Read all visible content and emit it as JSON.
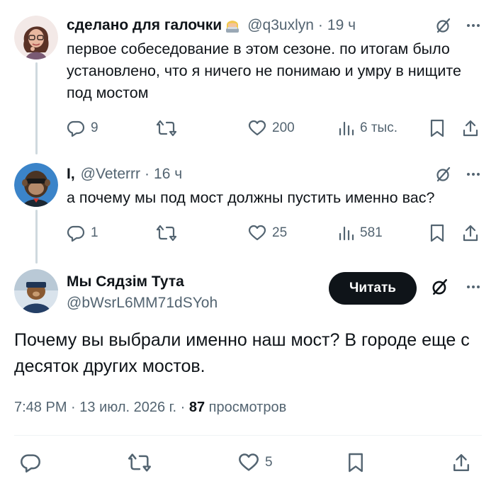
{
  "tweets": [
    {
      "name": "сделано для галочки",
      "handle": "@q3uxlyn",
      "time": "19 ч",
      "text": "первое собеседование в этом сезоне. по итогам было установлено, что я ничего не понимаю и умру в нищите под мостом",
      "replies": "9",
      "retweets": "",
      "likes": "200",
      "views": "6 тыс."
    },
    {
      "name": "I,",
      "handle": "@Veterrr",
      "time": "16 ч",
      "text": "а почему мы под мост должны пустить именно вас?",
      "replies": "1",
      "retweets": "",
      "likes": "25",
      "views": "581"
    }
  ],
  "main_tweet": {
    "name": "Мы Сядзім Тута",
    "handle": "@bWsrL6MM71dSYoh",
    "follow_label": "Читать",
    "text": "Почему вы выбрали именно наш мост? В городе еще с десяток других мостов.",
    "time": "7:48 PM",
    "date": "13 июл. 2026 г.",
    "views_count": "87",
    "views_label": "просмотров",
    "likes": "5"
  },
  "separator": "·",
  "colors": {
    "text": "#0f1419",
    "secondary": "#536471",
    "thread_line": "#cfd9de",
    "button_bg": "#0f1419"
  },
  "icons": [
    "reply-icon",
    "retweet-icon",
    "like-icon",
    "views-icon",
    "bookmark-icon",
    "share-icon",
    "grok-icon",
    "more-icon",
    "lady-emoji-icon"
  ]
}
